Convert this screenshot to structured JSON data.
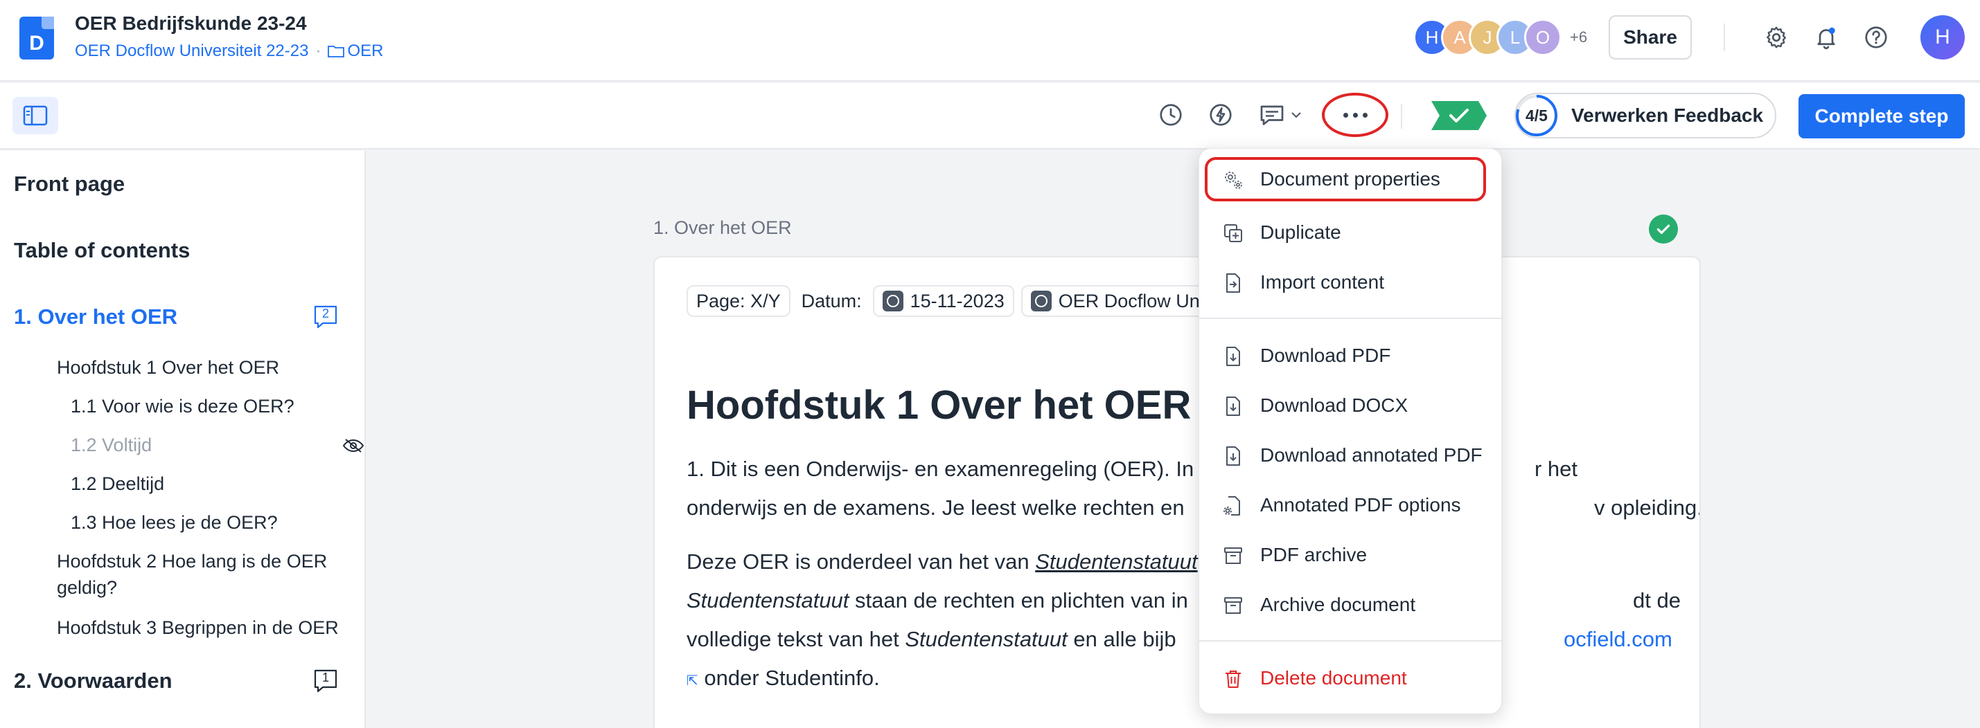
{
  "app": {
    "logo_letter": "D",
    "title": "OER Bedrijfskunde 23-24",
    "breadcrumb_parent": "OER Docflow Universiteit 22-23",
    "breadcrumb_separator": "·",
    "breadcrumb_folder": "OER"
  },
  "header": {
    "avatars": [
      {
        "letter": "H",
        "color": "#3b6ff5"
      },
      {
        "letter": "A",
        "color": "#f2b98a"
      },
      {
        "letter": "J",
        "color": "#e7c27a"
      },
      {
        "letter": "L",
        "color": "#9ab8f0"
      },
      {
        "letter": "O",
        "color": "#b7a4e6"
      }
    ],
    "more_count": "+6",
    "share_label": "Share",
    "user_initial": "H"
  },
  "toolbar": {
    "step_progress": "4/5",
    "step_fraction": 0.8,
    "step_label": "Verwerken Feedback",
    "complete_label": "Complete step"
  },
  "sidebar": {
    "front_page": "Front page",
    "toc": "Table of contents",
    "section1": {
      "label": "1. Over het OER",
      "comments": "2"
    },
    "items": [
      {
        "label": "Hoofdstuk 1 Over het OER"
      },
      {
        "label": "1.1 Voor wie is deze OER?"
      },
      {
        "label": "1.2 Voltijd"
      },
      {
        "label": "1.2 Deeltijd"
      },
      {
        "label": "1.3 Hoe lees je de OER?"
      },
      {
        "label": "Hoofdstuk 2 Hoe lang is de OER geldig?"
      },
      {
        "label": "Hoofdstuk 3 Begrippen in de OER"
      }
    ],
    "section2": {
      "label": "2. Voorwaarden",
      "comments": "1"
    }
  },
  "document": {
    "section_label": "1. Over het OER",
    "meta_page": "Page: X/Y",
    "meta_date_label": "Datum:",
    "meta_date_value": "15-11-2023",
    "meta_org": "OER Docflow Un",
    "heading": "Hoofdstuk 1  Over het OER",
    "p1_line1": "1.  Dit is een Onderwijs- en examenregeling (OER). In",
    "p1_line1_tail": "r het",
    "p1_line2": "onderwijs en de examens. Je leest welke rechten en",
    "p1_line2_tail": "v opleiding.",
    "p2_line1_a": "Deze OER is onderdeel van het van ",
    "p2_line1_b": "Studentenstatuut",
    "p2_line2_a": "Studentenstatuut",
    "p2_line2_b": " staan de rechten en plichten van in",
    "p2_line2_tail": "dt de",
    "p2_line3_a": "volledige tekst van het ",
    "p2_line3_b": "Studentenstatuut",
    "p2_line3_c": " en alle bijb",
    "p2_line3_link": "ocfield.com",
    "p2_line4": " onder Studentinfo."
  },
  "menu": {
    "items": [
      {
        "label": "Document properties",
        "icon": "gears-icon"
      },
      {
        "label": "Duplicate",
        "icon": "duplicate-icon"
      },
      {
        "label": "Import content",
        "icon": "import-icon"
      },
      {
        "label": "Download PDF",
        "icon": "download-icon"
      },
      {
        "label": "Download DOCX",
        "icon": "download-icon"
      },
      {
        "label": "Download annotated PDF",
        "icon": "download-icon"
      },
      {
        "label": "Annotated PDF options",
        "icon": "file-settings-icon"
      },
      {
        "label": "PDF archive",
        "icon": "archive-icon"
      },
      {
        "label": "Archive document",
        "icon": "archive-icon"
      },
      {
        "label": "Delete document",
        "icon": "trash-icon"
      }
    ]
  },
  "colors": {
    "accent": "#1d6ff2",
    "danger": "#e02424",
    "success": "#27ae6f"
  }
}
